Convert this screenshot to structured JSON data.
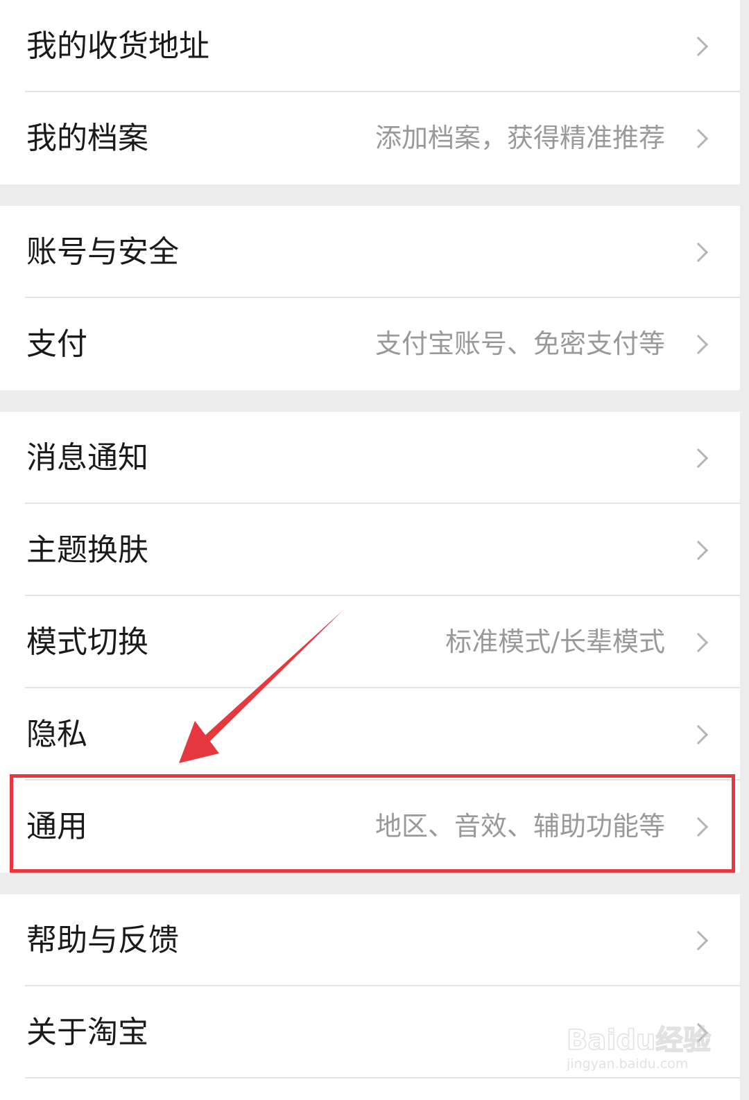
{
  "settings": {
    "sections": [
      {
        "items": [
          {
            "label": "我的收货地址",
            "hint": ""
          },
          {
            "label": "我的档案",
            "hint": "添加档案，获得精准推荐"
          }
        ]
      },
      {
        "items": [
          {
            "label": "账号与安全",
            "hint": ""
          },
          {
            "label": "支付",
            "hint": "支付宝账号、免密支付等"
          }
        ]
      },
      {
        "items": [
          {
            "label": "消息通知",
            "hint": ""
          },
          {
            "label": "主题换肤",
            "hint": ""
          },
          {
            "label": "模式切换",
            "hint": "标准模式/长辈模式"
          },
          {
            "label": "隐私",
            "hint": ""
          },
          {
            "label": "通用",
            "hint": "地区、音效、辅助功能等"
          }
        ]
      },
      {
        "items": [
          {
            "label": "帮助与反馈",
            "hint": ""
          },
          {
            "label": "关于淘宝",
            "hint": ""
          }
        ]
      }
    ]
  },
  "icons": {
    "row_arrow": "chevron-right-icon",
    "annotation": "red-pointer-arrow"
  },
  "colors": {
    "highlight": "#e5393f",
    "background": "#ececec",
    "row_background": "#ffffff",
    "label_text": "#1a1a1a",
    "hint_text": "#999999"
  },
  "watermark": {
    "logo": "Baidu经验",
    "url": "jingyan.baidu.com"
  }
}
